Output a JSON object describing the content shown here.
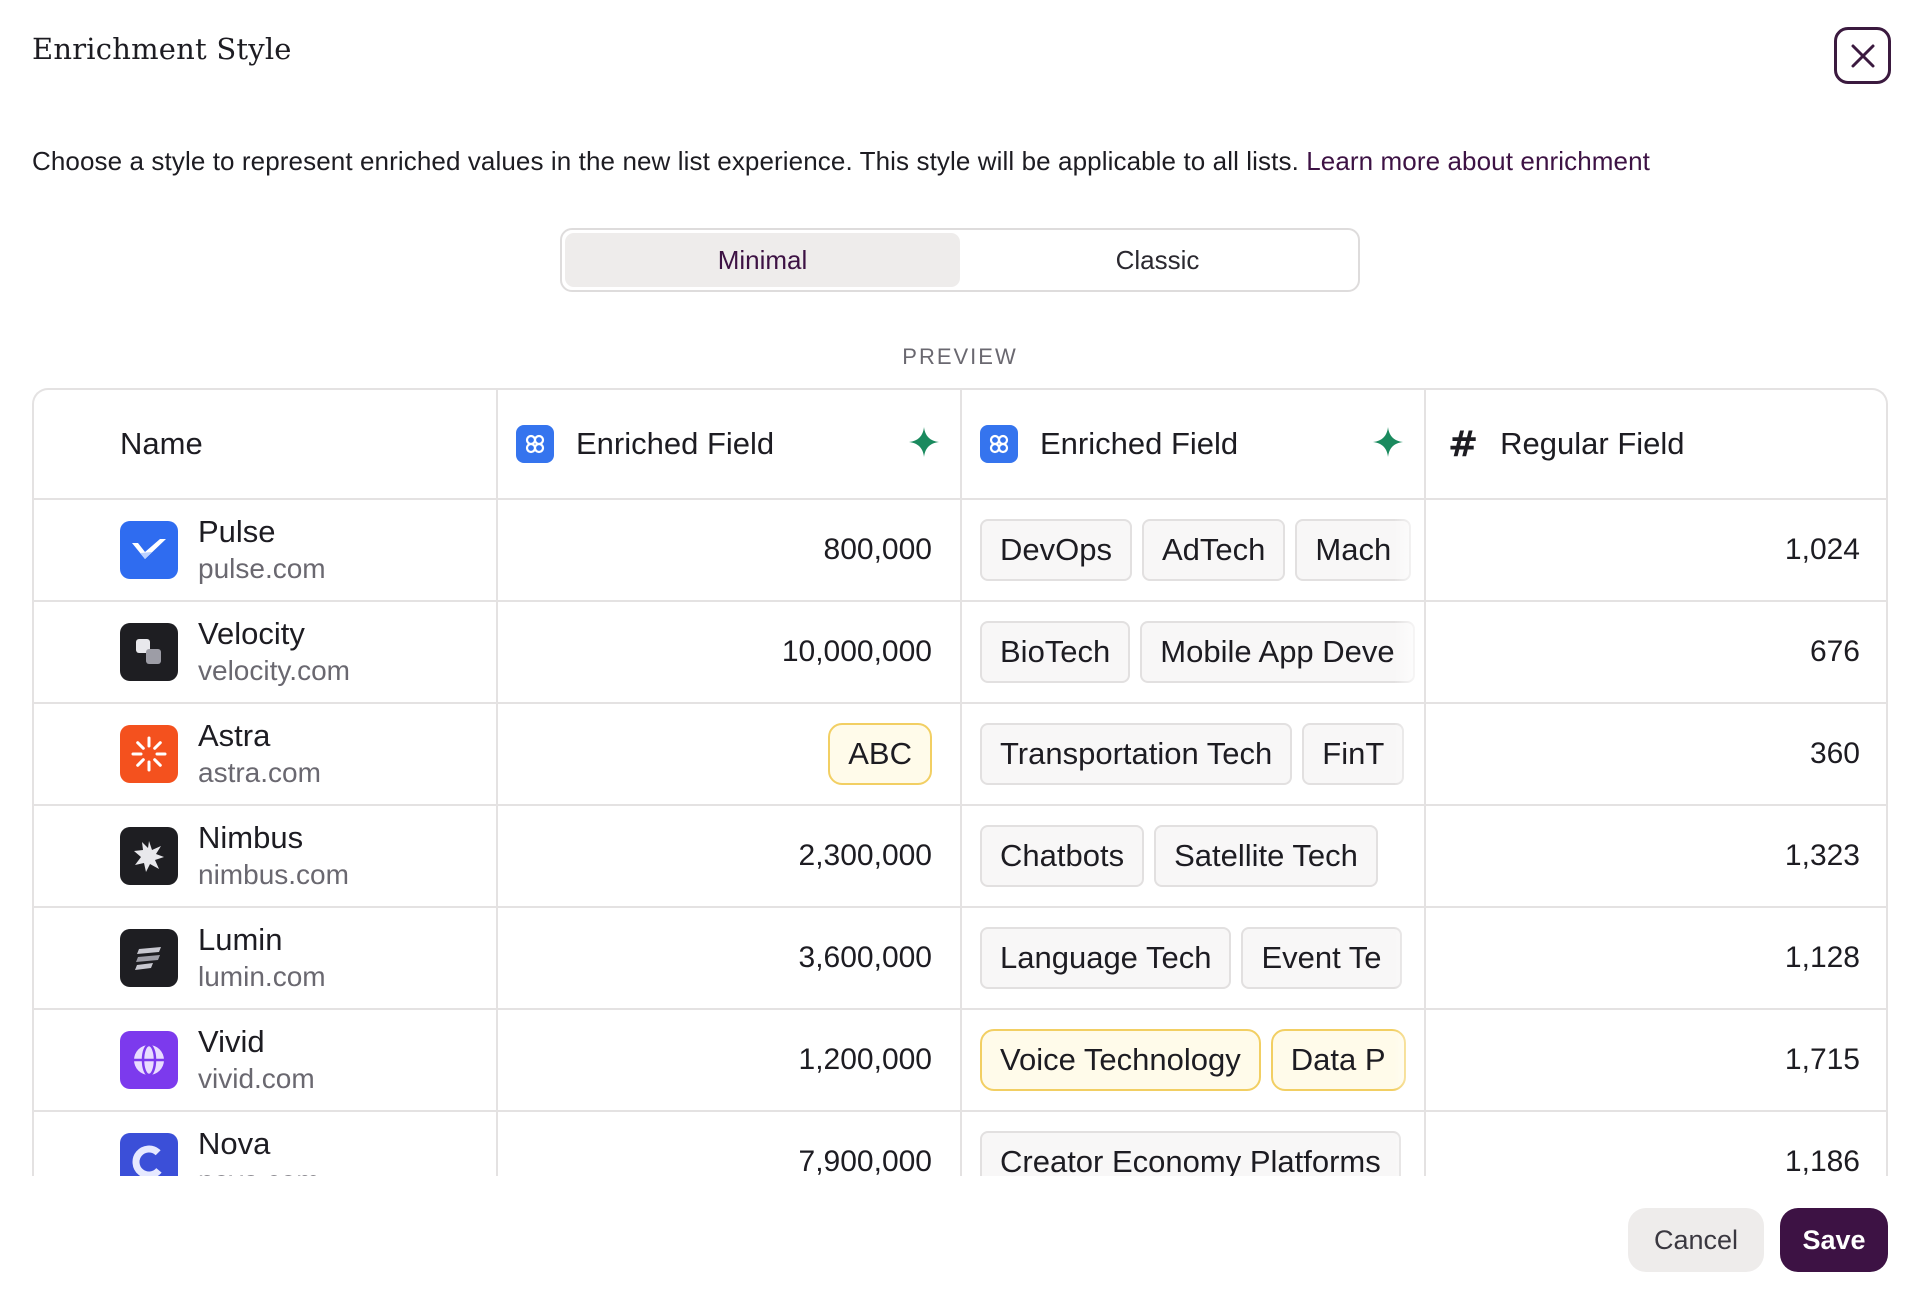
{
  "dialog": {
    "title": "Enrichment Style",
    "description": "Choose a style to represent enriched values in the new list experience. This style will be applicable to all lists.",
    "learn_more_link": "Learn more about enrichment",
    "close_icon": "close-icon"
  },
  "style_toggle": {
    "options": [
      "Minimal",
      "Classic"
    ],
    "selected": "Minimal"
  },
  "preview": {
    "label": "PREVIEW",
    "columns": [
      {
        "label": "Name",
        "icon": null
      },
      {
        "label": "Enriched Field",
        "icon": "enrichment-icon",
        "badge": "sparkle-icon"
      },
      {
        "label": "Enriched Field",
        "icon": "enrichment-icon",
        "badge": "sparkle-icon"
      },
      {
        "label": "Regular Field",
        "icon": "hash-icon"
      }
    ],
    "rows": [
      {
        "name": "Pulse",
        "domain": "pulse.com",
        "logo_color": "#2f6cf0",
        "enriched_value": "800,000",
        "tags": [
          "DevOps",
          "AdTech",
          "Mach"
        ],
        "regular": "1,024"
      },
      {
        "name": "Velocity",
        "domain": "velocity.com",
        "logo_color": "#1e1e22",
        "enriched_value": "10,000,000",
        "tags": [
          "BioTech",
          "Mobile App Deve"
        ],
        "regular": "676"
      },
      {
        "name": "Astra",
        "domain": "astra.com",
        "logo_color": "#f4511e",
        "enriched_value": "ABC",
        "tags": [
          "Transportation Tech",
          "FinT"
        ],
        "regular": "360"
      },
      {
        "name": "Nimbus",
        "domain": "nimbus.com",
        "logo_color": "#1e1e22",
        "enriched_value": "2,300,000",
        "tags": [
          "Chatbots",
          "Satellite Tech"
        ],
        "regular": "1,323"
      },
      {
        "name": "Lumin",
        "domain": "lumin.com",
        "logo_color": "#1e1e22",
        "enriched_value": "3,600,000",
        "tags": [
          "Language Tech",
          "Event Te"
        ],
        "regular": "1,128"
      },
      {
        "name": "Vivid",
        "domain": "vivid.com",
        "logo_color": "#7c3aed",
        "enriched_value": "1,200,000",
        "tags": [
          "Voice Technology",
          "Data P"
        ],
        "regular": "1,715"
      },
      {
        "name": "Nova",
        "domain": "nova.com",
        "logo_color": "#3b4fd8",
        "enriched_value": "7,900,000",
        "tags": [
          "Creator Economy Platforms"
        ],
        "regular": "1,186"
      }
    ]
  },
  "footer": {
    "cancel_label": "Cancel",
    "save_label": "Save"
  }
}
